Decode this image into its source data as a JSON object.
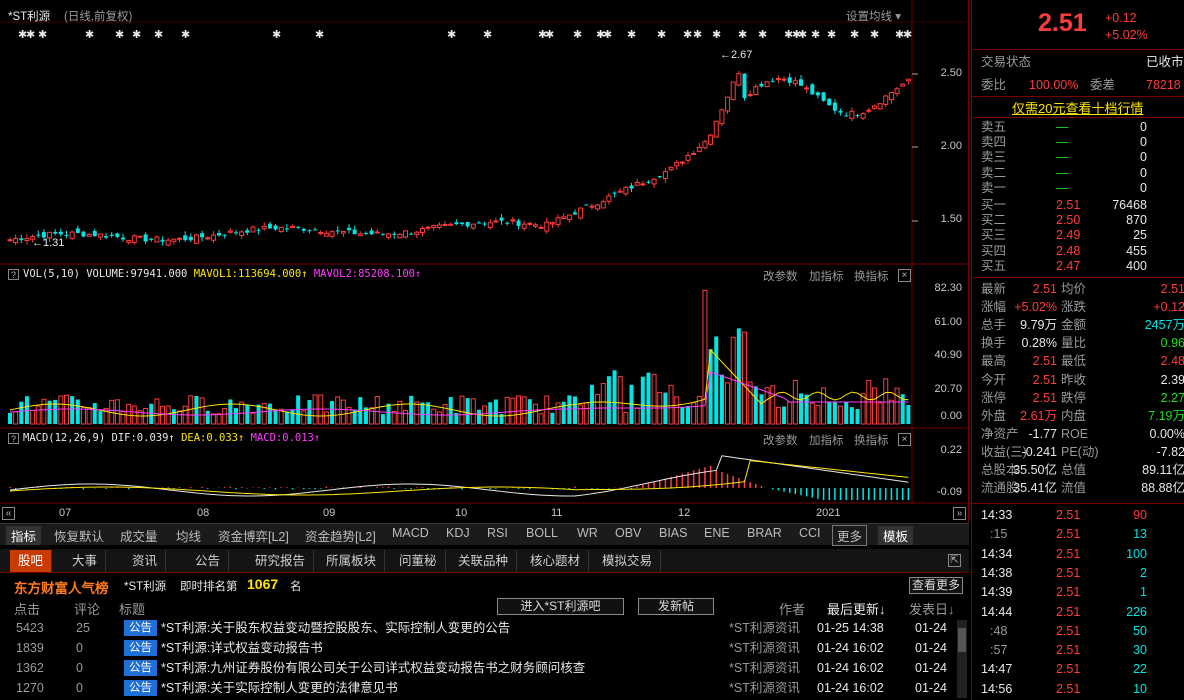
{
  "header": {
    "stock_name": "*ST利源",
    "period_label": "(日线,前复权)",
    "settings_label": "设置均线",
    "star_markers": [
      "✱",
      "✱",
      "✱",
      "✱",
      "✱",
      "✱",
      "✱",
      "✱",
      "✱",
      "✱",
      "✱",
      "✱",
      "✱",
      "✱",
      "✱",
      "✱",
      "✱",
      "✱",
      "✱",
      "✱",
      "✱",
      "✱",
      "✱",
      "✱",
      "✱",
      "✱",
      "✱",
      "✱"
    ]
  },
  "price_chart": {
    "high_label": "2.67",
    "low_label": "1.31",
    "y_axis": [
      "2.50",
      "2.00",
      "1.50"
    ]
  },
  "volume_panel": {
    "name": "VOL(5,10)",
    "volume_label": "VOLUME:97941.000",
    "mavol1_label": "MAVOL1:113694.000",
    "mavol2_label": "MAVOL2:85208.100",
    "y_axis": [
      "82.30",
      "61.00",
      "40.90",
      "20.70",
      "0.00"
    ],
    "buttons": [
      "改参数",
      "加指标",
      "换指标"
    ],
    "close_icon": "×"
  },
  "macd_panel": {
    "name": "MACD(12,26,9)",
    "dif_label": "DIF:0.039",
    "dea_label": "DEA:0.033",
    "macd_label": "MACD:0.013",
    "y_axis": [
      "0.22",
      "-0.09"
    ],
    "buttons": [
      "改参数",
      "加指标",
      "换指标"
    ],
    "close_icon": "×"
  },
  "x_axis": [
    "07",
    "08",
    "09",
    "10",
    "11",
    "12",
    "2021"
  ],
  "indicator_tabs": [
    "指标",
    "恢复默认",
    "成交量",
    "均线",
    "资金博弈[L2]",
    "资金趋势[L2]",
    "MACD",
    "KDJ",
    "RSI",
    "BOLL",
    "WR",
    "OBV",
    "BIAS",
    "ENE",
    "BRAR",
    "CCI",
    "更多",
    "模板"
  ],
  "news": {
    "tabs": [
      "股吧",
      "大事",
      "资讯",
      "公告",
      "研究报告",
      "所属板块",
      "问董秘",
      "关联品种",
      "核心题材",
      "模拟交易"
    ],
    "popularity_title": "东方财富人气榜",
    "popularity_stock": "*ST利源",
    "rank_label": "即时排名第",
    "rank_value": "1067",
    "rank_unit": "名",
    "see_more": "查看更多",
    "col_headers": {
      "clicks": "点击",
      "comments": "评论",
      "title": "标题",
      "author": "作者",
      "last_update": "最后更新↓",
      "published": "发表日↓"
    },
    "enter_bar_button": "进入*ST利源吧",
    "new_post_button": "发新帖",
    "rows": [
      {
        "clicks": "5423",
        "comments": "25",
        "tag": "公告",
        "title": "*ST利源:关于股东权益变动暨控股股东、实际控制人变更的公告",
        "author": "*ST利源资讯",
        "updated": "01-25 14:38",
        "date": "01-24"
      },
      {
        "clicks": "1839",
        "comments": "0",
        "tag": "公告",
        "title": "*ST利源:详式权益变动报告书",
        "author": "*ST利源资讯",
        "updated": "01-24 16:02",
        "date": "01-24"
      },
      {
        "clicks": "1362",
        "comments": "0",
        "tag": "公告",
        "title": "*ST利源:九州证券股份有限公司关于公司详式权益变动报告书之财务顾问核查",
        "author": "*ST利源资讯",
        "updated": "01-24 16:02",
        "date": "01-24"
      },
      {
        "clicks": "1270",
        "comments": "0",
        "tag": "公告",
        "title": "*ST利源:关于实际控制人变更的法律意见书",
        "author": "*ST利源资讯",
        "updated": "01-24 16:02",
        "date": "01-24"
      }
    ]
  },
  "quote": {
    "price": "2.51",
    "change": "+0.12",
    "change_pct": "+5.02%",
    "trade_status_label": "交易状态",
    "trade_status": "已收市",
    "weibi_label": "委比",
    "weibi": "100.00%",
    "weicha_label": "委差",
    "weicha": "78218",
    "level2_link": "仅需20元查看十档行情",
    "asks": [
      {
        "label": "卖五",
        "price": "—",
        "vol": "0"
      },
      {
        "label": "卖四",
        "price": "—",
        "vol": "0"
      },
      {
        "label": "卖三",
        "price": "—",
        "vol": "0"
      },
      {
        "label": "卖二",
        "price": "—",
        "vol": "0"
      },
      {
        "label": "卖一",
        "price": "—",
        "vol": "0"
      }
    ],
    "bids": [
      {
        "label": "买一",
        "price": "2.51",
        "vol": "76468"
      },
      {
        "label": "买二",
        "price": "2.50",
        "vol": "870"
      },
      {
        "label": "买三",
        "price": "2.49",
        "vol": "25"
      },
      {
        "label": "买四",
        "price": "2.48",
        "vol": "455"
      },
      {
        "label": "买五",
        "price": "2.47",
        "vol": "400"
      }
    ],
    "stats": [
      {
        "l1": "最新",
        "v1": "2.51",
        "c1": "red",
        "l2": "均价",
        "v2": "2.51",
        "c2": "red"
      },
      {
        "l1": "涨幅",
        "v1": "+5.02%",
        "c1": "red",
        "l2": "涨跌",
        "v2": "+0.12",
        "c2": "red"
      },
      {
        "l1": "总手",
        "v1": "9.79万",
        "c1": "wht",
        "l2": "金额",
        "v2": "2457万",
        "c2": "cyan"
      },
      {
        "l1": "换手",
        "v1": "0.28%",
        "c1": "wht",
        "l2": "量比",
        "v2": "0.96",
        "c2": "green"
      },
      {
        "l1": "最高",
        "v1": "2.51",
        "c1": "red",
        "l2": "最低",
        "v2": "2.48",
        "c2": "red"
      },
      {
        "l1": "今开",
        "v1": "2.51",
        "c1": "red",
        "l2": "昨收",
        "v2": "2.39",
        "c2": "wht"
      },
      {
        "l1": "涨停",
        "v1": "2.51",
        "c1": "red",
        "l2": "跌停",
        "v2": "2.27",
        "c2": "green"
      },
      {
        "l1": "外盘",
        "v1": "2.61万",
        "c1": "red",
        "l2": "内盘",
        "v2": "7.19万",
        "c2": "green"
      },
      {
        "l1": "净资产",
        "v1": "-1.77",
        "c1": "wht",
        "l2": "ROE",
        "v2": "0.00%",
        "c2": "wht"
      },
      {
        "l1": "收益(三)",
        "v1": "-0.241",
        "c1": "wht",
        "l2": "PE(动)",
        "v2": "-7.82",
        "c2": "wht"
      },
      {
        "l1": "总股本",
        "v1": "35.50亿",
        "c1": "wht",
        "l2": "总值",
        "v2": "89.11亿",
        "c2": "wht"
      },
      {
        "l1": "流通股",
        "v1": "35.41亿",
        "c1": "wht",
        "l2": "流值",
        "v2": "88.88亿",
        "c2": "wht"
      }
    ],
    "ticks": [
      {
        "time": "14:33",
        "price": "2.51",
        "vol": "90",
        "c": "red"
      },
      {
        "time": ":15",
        "price": "2.51",
        "vol": "13",
        "c": "cyan"
      },
      {
        "time": "14:34",
        "price": "2.51",
        "vol": "100",
        "c": "cyan"
      },
      {
        "time": "14:38",
        "price": "2.51",
        "vol": "2",
        "c": "cyan"
      },
      {
        "time": "14:39",
        "price": "2.51",
        "vol": "1",
        "c": "cyan"
      },
      {
        "time": "14:44",
        "price": "2.51",
        "vol": "226",
        "c": "cyan"
      },
      {
        "time": ":48",
        "price": "2.51",
        "vol": "50",
        "c": "cyan"
      },
      {
        "time": ":57",
        "price": "2.51",
        "vol": "30",
        "c": "cyan"
      },
      {
        "time": "14:47",
        "price": "2.51",
        "vol": "22",
        "c": "cyan"
      },
      {
        "time": "14:56",
        "price": "2.51",
        "vol": "10",
        "c": "cyan"
      }
    ]
  },
  "colors": {
    "up": "#ff3c3c",
    "down": "#00e4e4",
    "accent": "#c83a00",
    "frame": "#7a0000",
    "blue_tag": "#1f6fd6"
  }
}
